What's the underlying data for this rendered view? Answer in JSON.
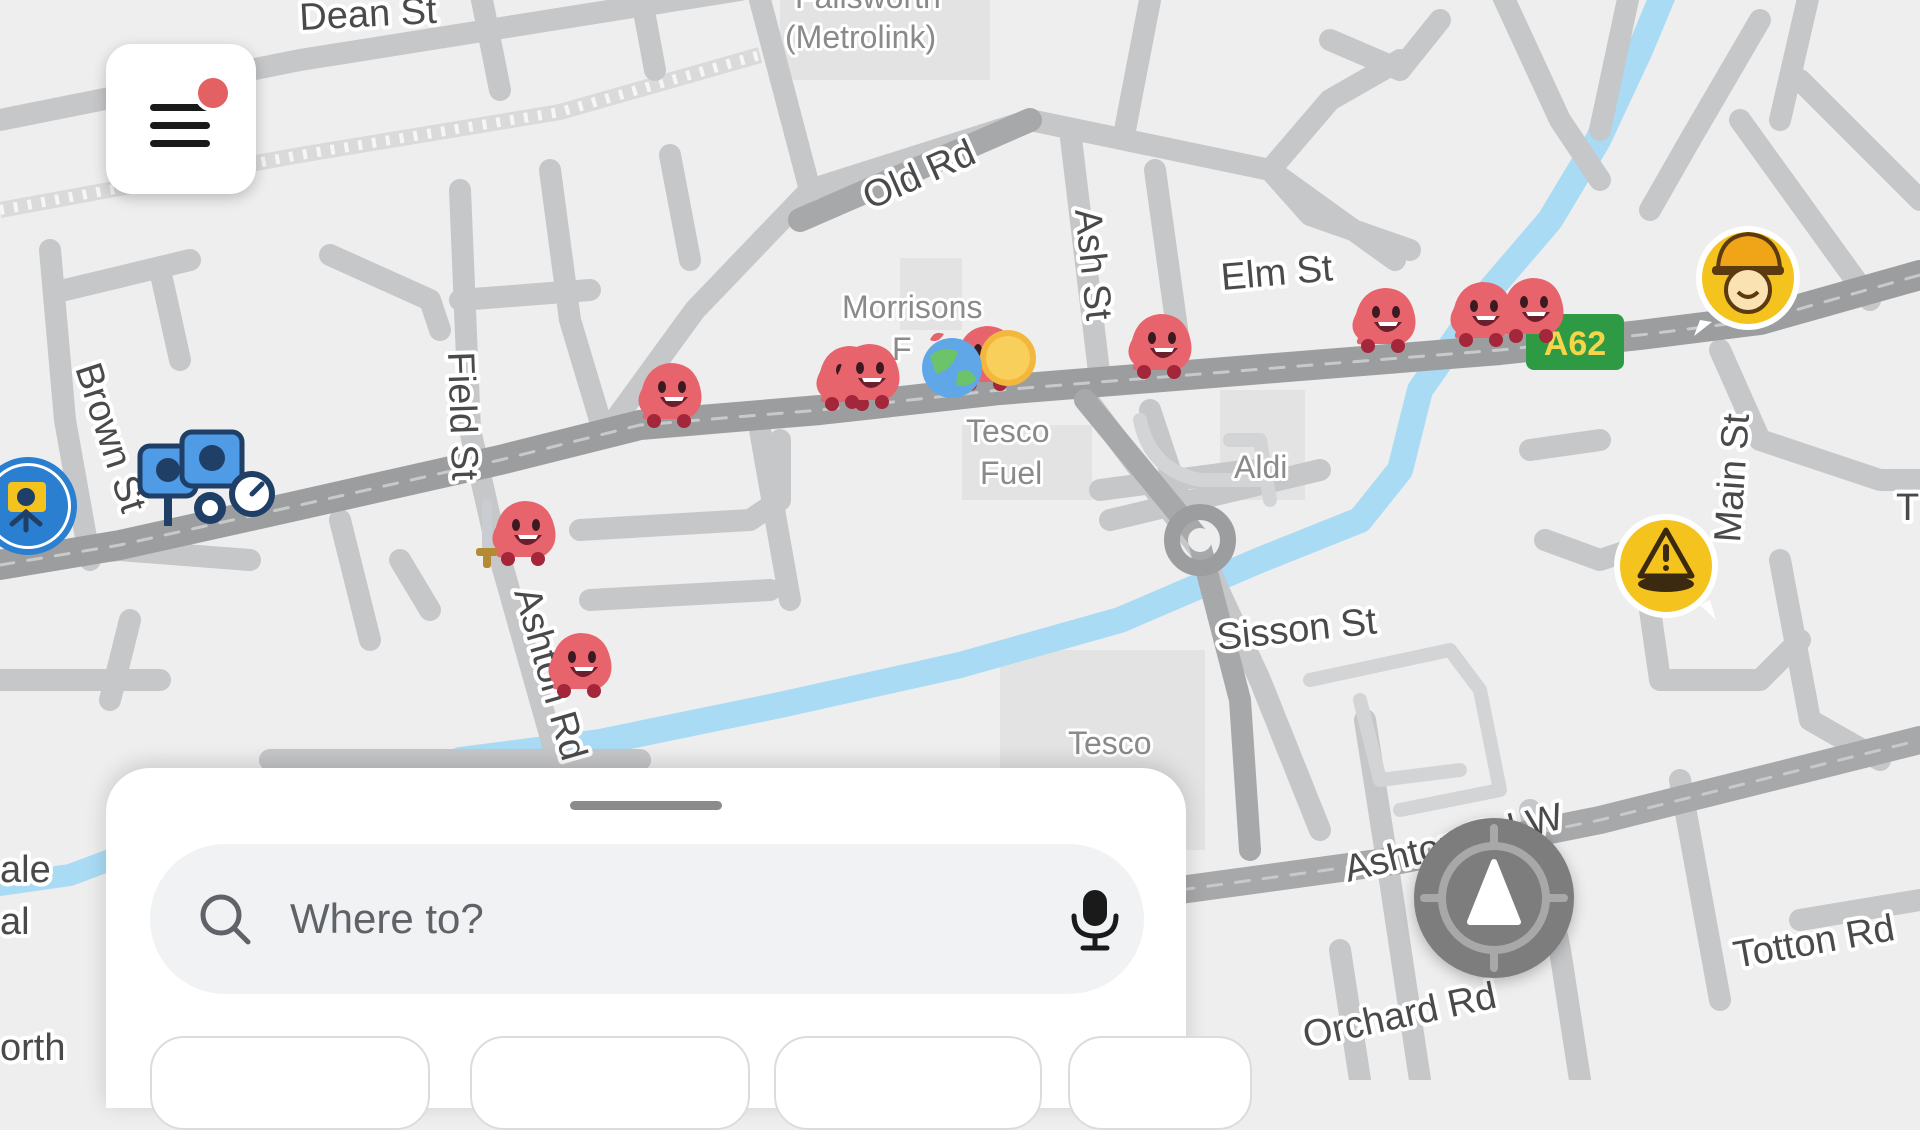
{
  "colors": {
    "map_background": "#eeeeee",
    "road": "#c6c7c9",
    "main_road": "#9c9d9f",
    "water": "#a9dbf5",
    "wazer": "#e8646c",
    "hazard": "#f4c31e",
    "highway_badge": "#2e9b44",
    "camera": "#2a7fd0"
  },
  "menu": {
    "has_notification": true
  },
  "streets": {
    "dean_st": "Dean St",
    "metrolink": "(Metrolink)",
    "metrolink_top": "Failsworth",
    "old_rd": "Old Rd",
    "ash_st": "Ash St",
    "elm_st": "Elm St",
    "brown_st": "Brown St",
    "field_st": "Field St",
    "ashton_rd": "Ashton Rd",
    "sisson_st": "Sisson St",
    "main_st": "Main St",
    "ashton_rd_w": "Ashton Rd W",
    "totton_rd": "Totton Rd",
    "orchard_rd": "Orchard Rd",
    "edge_ale": "ale",
    "edge_al": "al",
    "edge_orth": "orth",
    "edge_t": "T"
  },
  "pois": {
    "morrisons": "Morrisons",
    "morrisons_cut": "F",
    "tesco_fuel_1": "Tesco",
    "tesco_fuel_2": "Fuel",
    "aldi": "Aldi",
    "tesco": "Tesco"
  },
  "highway_badge": "A62",
  "search": {
    "placeholder": "Where to?"
  },
  "icons": {
    "menu": "menu-icon",
    "search": "search-icon",
    "mic": "microphone-icon",
    "recenter": "recenter-icon",
    "speed_camera": "speed-camera-icon",
    "red_light_camera": "camera-icon",
    "construction": "construction-worker-icon",
    "hazard": "hazard-icon",
    "wazer": "wazer-icon"
  }
}
